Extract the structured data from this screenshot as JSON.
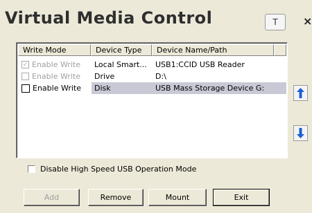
{
  "window": {
    "title": "Virtual Media Control",
    "pin_label": "T",
    "close_label": "×"
  },
  "table": {
    "columns": [
      "Write Mode",
      "Device Type",
      "Device Name/Path"
    ],
    "rows": [
      {
        "write_mode": "Enable Write",
        "checked": true,
        "enabled": false,
        "device_type": "Local Smart...",
        "device_name": "USB1:CCID USB Reader"
      },
      {
        "write_mode": "Enable Write",
        "checked": false,
        "enabled": false,
        "device_type": "Drive",
        "device_name": "D:\\"
      },
      {
        "write_mode": "Enable Write",
        "checked": false,
        "enabled": true,
        "selected": true,
        "device_type": "Disk",
        "device_name": "USB Mass Storage Device G:"
      }
    ]
  },
  "side_buttons": {
    "up_icon": "arrow-up-icon",
    "down_icon": "arrow-down-icon",
    "arrow_color": "#1a5fd6"
  },
  "option": {
    "label": "Disable High Speed USB Operation Mode",
    "checked": false
  },
  "buttons": {
    "add": "Add",
    "remove": "Remove",
    "mount": "Mount",
    "exit": "Exit"
  },
  "row_checkmark": "✓"
}
